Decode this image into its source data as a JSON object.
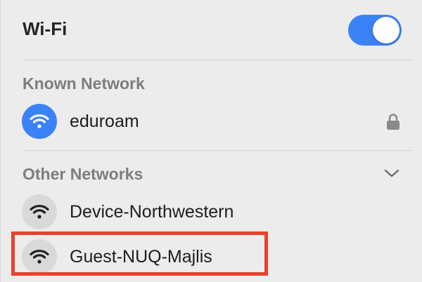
{
  "header": {
    "title": "Wi-Fi",
    "toggle_on": true
  },
  "known": {
    "header": "Known Network",
    "networks": [
      {
        "name": "eduroam",
        "icon": "wifi-icon",
        "secured": true,
        "connected": true
      }
    ]
  },
  "other": {
    "header": "Other Networks",
    "chevron": "chevron-down-icon",
    "networks": [
      {
        "name": "Device-Northwestern",
        "icon": "wifi-icon"
      },
      {
        "name": "Guest-NUQ-Majlis",
        "icon": "wifi-icon"
      }
    ]
  },
  "colors": {
    "accent": "#3b82f6",
    "highlight": "#e8412c",
    "panel_bg": "#ececec"
  }
}
